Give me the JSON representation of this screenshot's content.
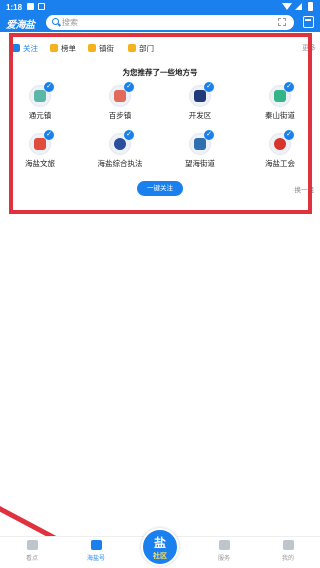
{
  "status_bar": {
    "time": "1:18"
  },
  "header": {
    "logo_text": "爱海盐",
    "search_placeholder": "搜索"
  },
  "tabs": [
    {
      "label": "关注",
      "active": true,
      "icon": "follow-icon"
    },
    {
      "label": "榜单",
      "active": false,
      "icon": "ranking-icon"
    },
    {
      "label": "镇街",
      "active": false,
      "icon": "town-icon"
    },
    {
      "label": "部门",
      "active": false,
      "icon": "department-icon"
    }
  ],
  "more_label": "更多",
  "recommend_title": "为您推荐了一些地方号",
  "accounts": [
    {
      "name": "通元镇",
      "color": "#5bb6a8"
    },
    {
      "name": "百步镇",
      "color": "#e26a5a"
    },
    {
      "name": "开发区",
      "color": "#213a7a"
    },
    {
      "name": "秦山街道",
      "color": "#35b389"
    },
    {
      "name": "海盐文旅",
      "color": "#e14b3b"
    },
    {
      "name": "海盐综合执法",
      "color": "#2b4f9e"
    },
    {
      "name": "望海街道",
      "color": "#2f6fb0"
    },
    {
      "name": "海盐工会",
      "color": "#d7352b"
    }
  ],
  "follow_all_label": "一键关注",
  "refresh_label": "换一组",
  "bottom_nav": [
    {
      "label": "看点",
      "active": false
    },
    {
      "label": "海盐号",
      "active": true
    },
    {
      "label": "服务",
      "active": false
    },
    {
      "label": "我的",
      "active": false
    }
  ],
  "center_button": {
    "line1": "盐",
    "line2": "社区"
  },
  "colors": {
    "primary": "#1a80ee",
    "annotation": "#e0323e"
  }
}
